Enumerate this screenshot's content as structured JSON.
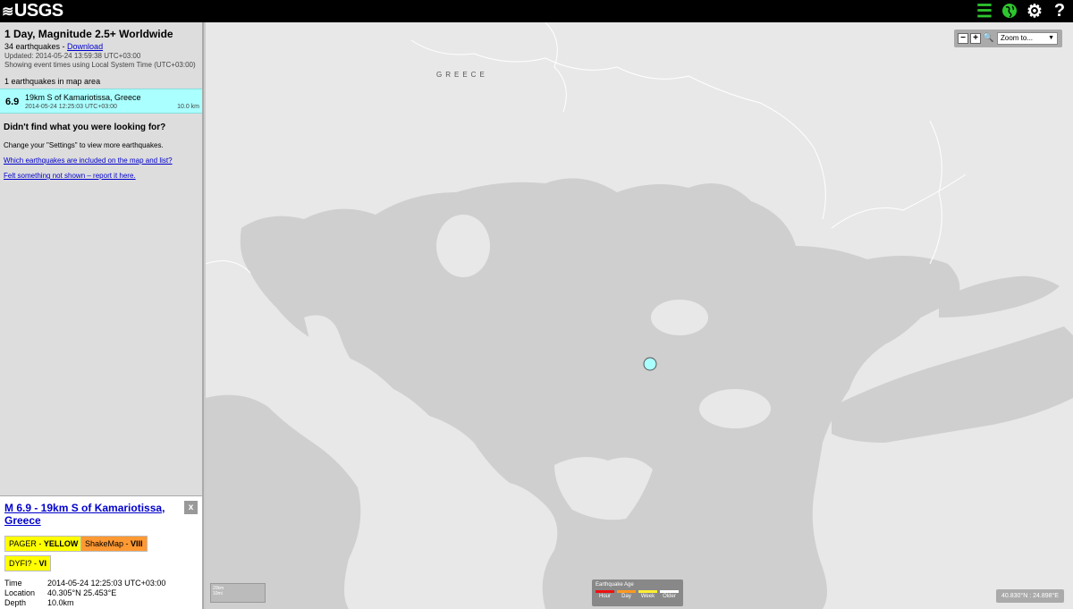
{
  "header": {
    "logo_text": "USGS",
    "icons": [
      "list-icon",
      "globe-icon",
      "gear-icon",
      "help-icon"
    ]
  },
  "sidebar": {
    "title": "1 Day, Magnitude 2.5+ Worldwide",
    "count_text": "34 earthquakes - ",
    "download_label": "Download",
    "updated": "Updated: 2014-05-24 13:59:38 UTC+03:00",
    "timezone_note": "Showing event times using Local System Time (UTC+03:00)",
    "in_map": "1 earthquakes in map area",
    "items": [
      {
        "mag": "6.9",
        "place": "19km S of Kamariotissa, Greece",
        "time": "2014-05-24 12:25:03 UTC+03:00",
        "depth": "10.0 km"
      }
    ],
    "not_found_title": "Didn't find what you were looking for?",
    "not_found_text": "Change your \"Settings\" to view more earthquakes.",
    "link_which": "Which earthquakes are included on the map and list?",
    "link_felt": "Felt something not shown – report it here."
  },
  "detail": {
    "title": "M 6.9 - 19km S of Kamariotissa, Greece",
    "close_label": "x",
    "pager_label": "PAGER - ",
    "pager_value": "YELLOW",
    "shakemap_label": "ShakeMap - ",
    "shakemap_value": "VIII",
    "dyfi_label": "DYFI? - ",
    "dyfi_value": "VI",
    "rows": [
      {
        "k": "Time",
        "v": "2014-05-24 12:25:03 UTC+03:00"
      },
      {
        "k": "Location",
        "v": "40.305°N 25.453°E"
      },
      {
        "k": "Depth",
        "v": "10.0km"
      }
    ]
  },
  "map": {
    "country_label": "GREECE",
    "zoom_in": "+",
    "zoom_out": "−",
    "zoom_select": "Zoom to...",
    "scale_km": "20km",
    "scale_mi": "10mi",
    "legend_title": "Earthquake Age",
    "legend_labels": [
      "Hour",
      "Day",
      "Week",
      "Older"
    ],
    "legend_colors": [
      "#ee1111",
      "#ff9922",
      "#ffee33",
      "#ffffff"
    ],
    "coordinates": "40.830°N : 24.898°E"
  }
}
